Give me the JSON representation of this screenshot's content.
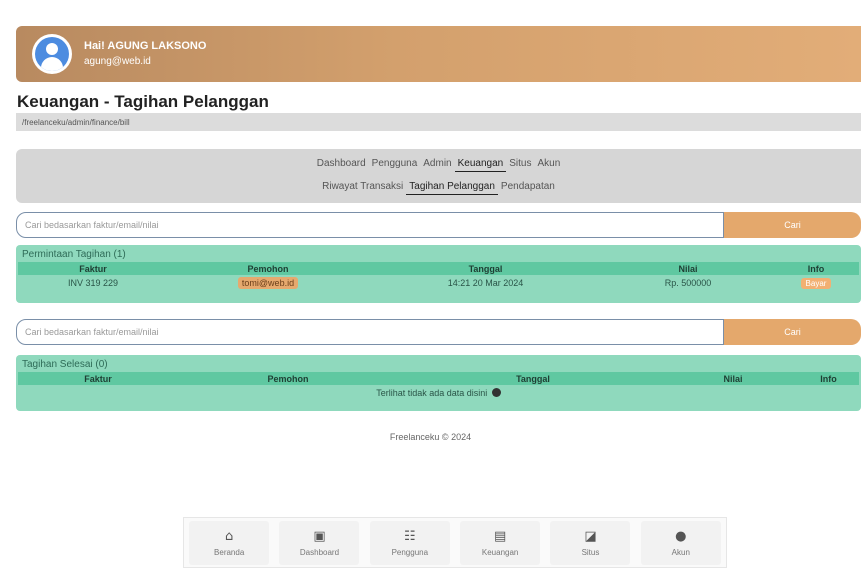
{
  "user": {
    "greeting": "Hai! AGUNG LAKSONO",
    "email": "agung@web.id"
  },
  "page": {
    "title": "Keuangan - Tagihan Pelanggan",
    "breadcrumb": "/freelanceku/admin/finance/bill"
  },
  "nav": {
    "primary": [
      "Dashboard",
      "Pengguna",
      "Admin",
      "Keuangan",
      "Situs",
      "Akun"
    ],
    "secondary": [
      "Riwayat Transaksi",
      "Tagihan Pelanggan",
      "Pendapatan"
    ]
  },
  "search1": {
    "placeholder": "Cari bedasarkan faktur/email/nilai",
    "button": "Cari"
  },
  "search2": {
    "placeholder": "Cari bedasarkan faktur/email/nilai",
    "button": "Cari"
  },
  "pending": {
    "title": "Permintaan Tagihan (1)",
    "headers": [
      "Faktur",
      "Pemohon",
      "Tanggal",
      "Nilai",
      "Info"
    ],
    "rows": [
      {
        "faktur": "INV 319 229",
        "pemohon": "tomi@web.id",
        "tanggal": "14:21 20 Mar 2024",
        "nilai": "Rp. 500000",
        "info": "Bayar"
      }
    ]
  },
  "done": {
    "title": "Tagihan Selesai (0)",
    "headers": [
      "Faktur",
      "Pemohon",
      "Tanggal",
      "Nilai",
      "Info"
    ],
    "empty": "Terlihat tidak ada data disini"
  },
  "footer": "Freelanceku © 2024",
  "bottom_nav": [
    {
      "label": "Beranda",
      "icon": "home-icon",
      "glyph": "⌂"
    },
    {
      "label": "Dashboard",
      "icon": "dashboard-icon",
      "glyph": "▣"
    },
    {
      "label": "Pengguna",
      "icon": "users-icon",
      "glyph": "☷"
    },
    {
      "label": "Keuangan",
      "icon": "finance-icon",
      "glyph": "▤"
    },
    {
      "label": "Situs",
      "icon": "site-icon",
      "glyph": "◪"
    },
    {
      "label": "Akun",
      "icon": "account-icon",
      "glyph": "●"
    }
  ]
}
